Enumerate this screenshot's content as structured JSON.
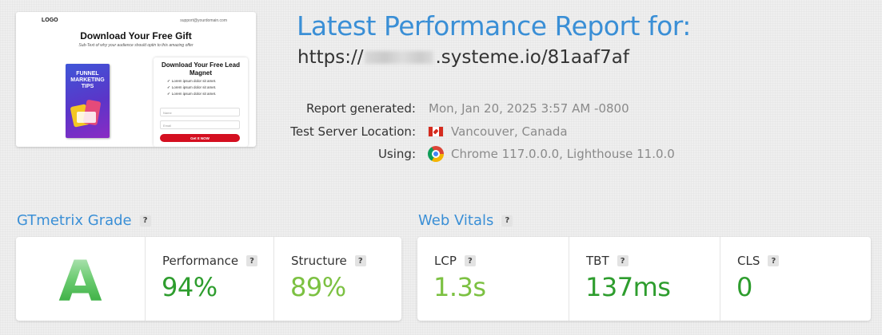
{
  "thumbnail": {
    "logo": "LOGO",
    "email": "support@yourdomain.com",
    "headline": "Download Your Free Gift",
    "subtext": "Sub-Text of why your audience should optin to this amazing offer",
    "book_title": "FUNNEL MARKETING TIPS",
    "card_title": "Download Your Free Lead Magnet",
    "bullets": [
      "Lorem ipsum dolor sit amet.",
      "Lorem ipsum dolor sit amet.",
      "Lorem ipsum dolor sit amet."
    ],
    "name_placeholder": "Name",
    "email_placeholder": "Email",
    "button_label": "Get It NOW"
  },
  "header": {
    "title": "Latest Performance Report for:",
    "url_prefix": "https://",
    "url_suffix": ".systeme.io/81aaf7af"
  },
  "meta": {
    "report_label": "Report generated:",
    "report_value": "Mon, Jan 20, 2025 3:57 AM -0800",
    "location_label": "Test Server Location:",
    "location_value": "Vancouver, Canada",
    "using_label": "Using:",
    "using_value": "Chrome 117.0.0.0, Lighthouse 11.0.0"
  },
  "grade": {
    "section_title": "GTmetrix Grade",
    "help": "?",
    "letter": "A",
    "performance_label": "Performance",
    "performance_value": "94%",
    "structure_label": "Structure",
    "structure_value": "89%"
  },
  "vitals": {
    "section_title": "Web Vitals",
    "help": "?",
    "lcp_label": "LCP",
    "lcp_value": "1.3s",
    "tbt_label": "TBT",
    "tbt_value": "137ms",
    "cls_label": "CLS",
    "cls_value": "0"
  },
  "colors": {
    "accent": "#3a8fd6",
    "green_dark": "#2e9d2e",
    "green_light": "#7cc142",
    "grade_green": "#3fb54a"
  }
}
